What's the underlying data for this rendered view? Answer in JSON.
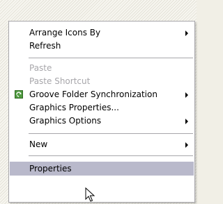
{
  "context_menu": {
    "items": [
      {
        "label": "Arrange Icons By"
      },
      {
        "label": "Refresh"
      },
      {
        "label": "Paste"
      },
      {
        "label": "Paste Shortcut"
      },
      {
        "label": "Groove Folder Synchronization"
      },
      {
        "label": "Graphics Properties..."
      },
      {
        "label": "Graphics Options"
      },
      {
        "label": "New"
      },
      {
        "label": "Properties"
      }
    ]
  },
  "colors": {
    "menu_background": "#ffffff",
    "selection": "#b9b9cb",
    "disabled_text": "#a7a6aa",
    "separator": "#a7a6aa"
  },
  "icons": [
    "groove-sync-icon",
    "submenu-arrow-icon",
    "mouse-pointer-icon"
  ]
}
